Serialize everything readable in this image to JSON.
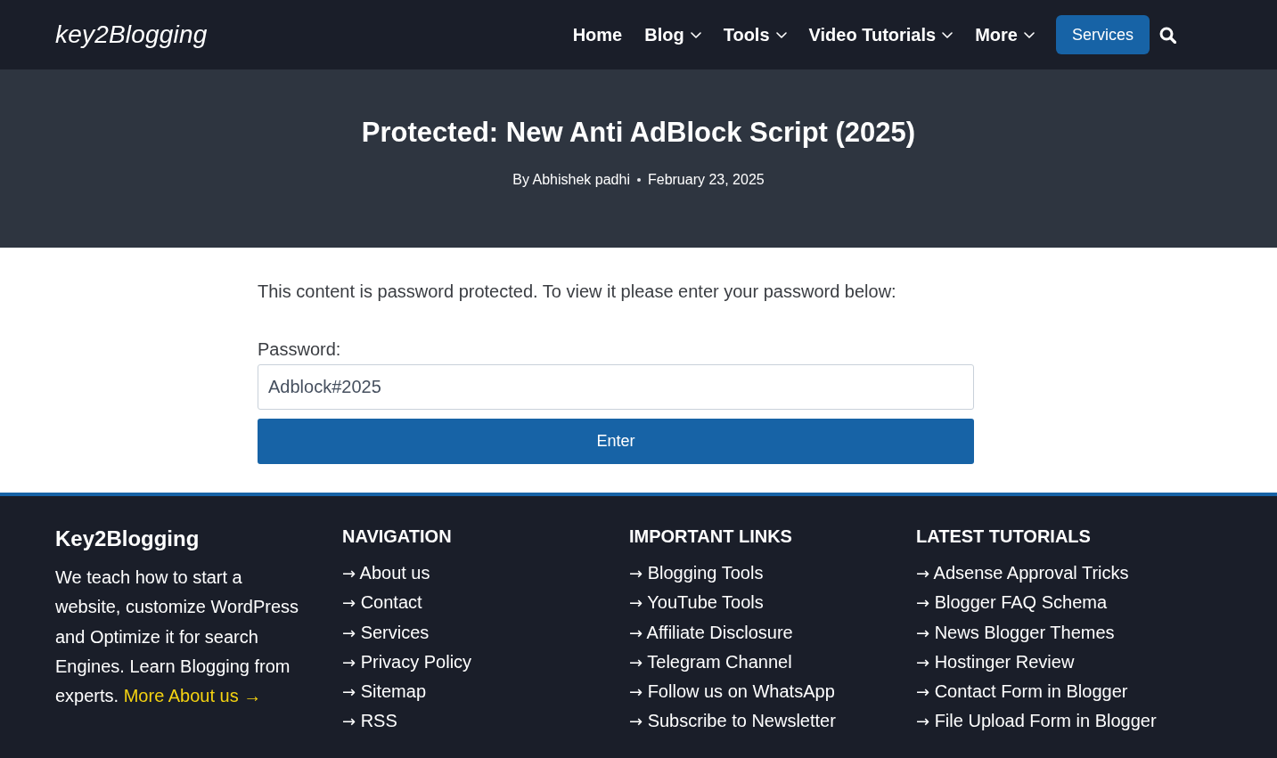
{
  "header": {
    "logo": "key2Blogging",
    "nav": [
      {
        "label": "Home",
        "dropdown": false
      },
      {
        "label": "Blog",
        "dropdown": true
      },
      {
        "label": "Tools",
        "dropdown": true
      },
      {
        "label": "Video Tutorials",
        "dropdown": true
      },
      {
        "label": "More",
        "dropdown": true
      }
    ],
    "cta": "Services"
  },
  "hero": {
    "title": "Protected: New Anti AdBlock Script (2025)",
    "author": "By Abhishek padhi",
    "date": "February 23, 2025"
  },
  "form": {
    "message": "This content is password protected. To view it please enter your password below:",
    "label": "Password:",
    "value": "Adblock#2025",
    "button": "Enter"
  },
  "footer": {
    "about": {
      "title": "Key2Blogging",
      "text": "We teach how to start a website, customize WordPress and Optimize it for search Engines. Learn Blogging from experts.",
      "link": "More About us →"
    },
    "columns": [
      {
        "heading": "NAVIGATION",
        "links": [
          "→ About us",
          "→ Contact",
          "→ Services",
          "→ Privacy Policy",
          "→ Sitemap",
          "→ RSS"
        ]
      },
      {
        "heading": "IMPORTANT LINKS",
        "links": [
          "→ Blogging Tools",
          "→ YouTube Tools",
          "→ Affiliate Disclosure",
          "→ Telegram Channel",
          "→ Follow us on WhatsApp",
          "→ Subscribe to Newsletter"
        ]
      },
      {
        "heading": "LATEST TUTORIALS",
        "links": [
          "→ Adsense Approval Tricks",
          "→ Blogger FAQ Schema",
          "→ News Blogger Themes",
          "→ Hostinger Review",
          "→ Contact Form in Blogger",
          "→ File Upload Form in Blogger"
        ]
      }
    ]
  }
}
